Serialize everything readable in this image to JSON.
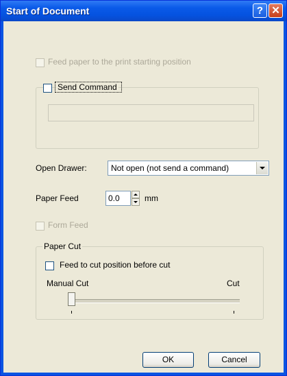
{
  "window": {
    "title": "Start of Document"
  },
  "feed_paper": {
    "label": "Feed paper to the print starting position",
    "checked": false,
    "enabled": false
  },
  "send_command": {
    "label": "Send Command",
    "checked": false,
    "value": ""
  },
  "open_drawer": {
    "label": "Open Drawer:",
    "value": "Not open (not send a command)"
  },
  "paper_feed": {
    "label": "Paper Feed",
    "value": "0.0",
    "unit": "mm"
  },
  "form_feed": {
    "label": "Form Feed",
    "checked": false,
    "enabled": false
  },
  "paper_cut": {
    "title": "Paper Cut",
    "feed_to_cut": {
      "label": "Feed to cut position before cut",
      "checked": false
    },
    "slider": {
      "left_label": "Manual Cut",
      "right_label": "Cut",
      "position": 0
    }
  },
  "buttons": {
    "ok": "OK",
    "cancel": "Cancel"
  }
}
